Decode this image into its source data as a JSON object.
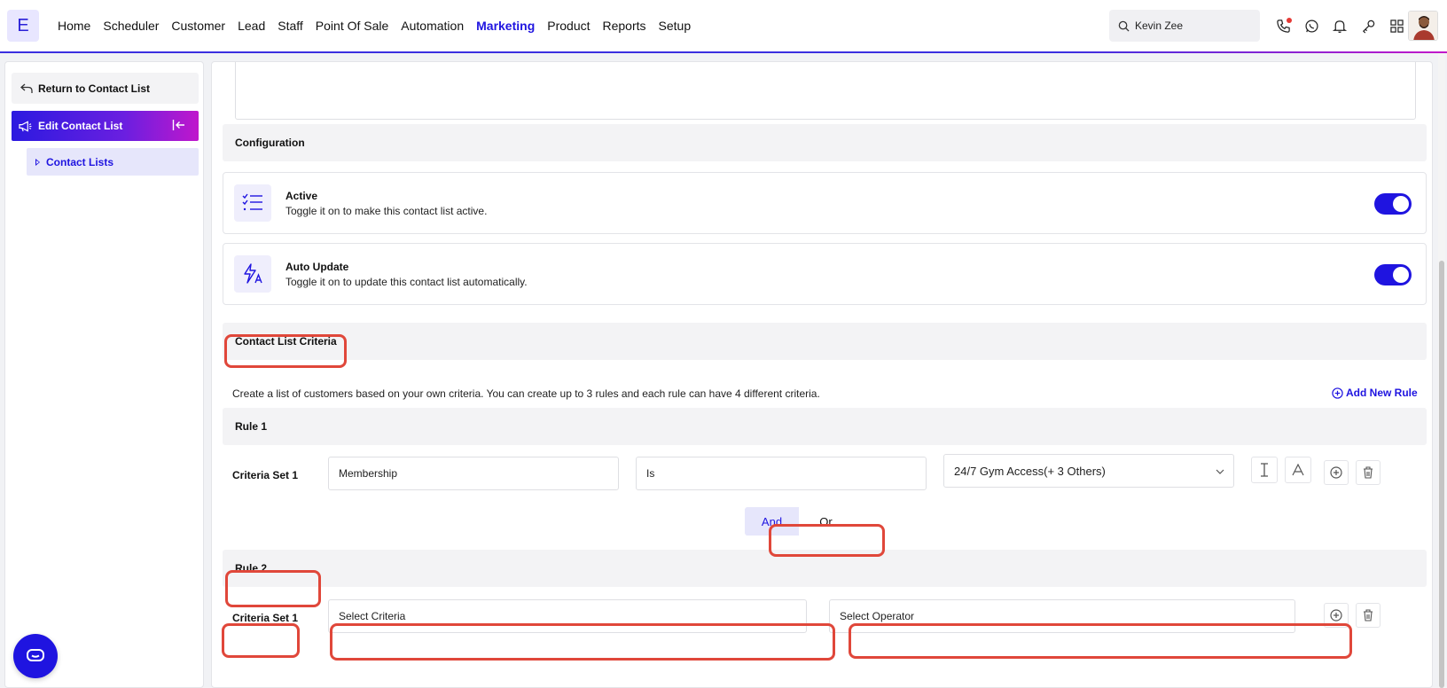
{
  "app": {
    "logo_letter": "E"
  },
  "nav": {
    "items": [
      "Home",
      "Scheduler",
      "Customer",
      "Lead",
      "Staff",
      "Point Of Sale",
      "Automation",
      "Marketing",
      "Product",
      "Reports",
      "Setup"
    ],
    "active": "Marketing"
  },
  "search": {
    "value": "Kevin Zee"
  },
  "top_icons": [
    "phone-icon",
    "whatsapp-icon",
    "bell-icon",
    "key-icon",
    "apps-grid-icon"
  ],
  "sidebar": {
    "back_label": "Return to Contact List",
    "edit_label": "Edit Contact List",
    "sub_label": "Contact Lists"
  },
  "config": {
    "header": "Configuration",
    "active": {
      "title": "Active",
      "desc": "Toggle it on to make this contact list active.",
      "on": true
    },
    "auto_update": {
      "title": "Auto Update",
      "desc": "Toggle it on to update this contact list automatically.",
      "on": true
    }
  },
  "criteria": {
    "header": "Contact List Criteria",
    "desc": "Create a list of customers based on your own criteria. You can create up to 3 rules and each rule can have 4 different criteria.",
    "add_rule": "Add New Rule",
    "rule1": {
      "header": "Rule 1",
      "set_label": "Criteria Set 1",
      "criteria": "Membership",
      "operator": "Is",
      "value": "24/7 Gym Access(+ 3 Others)"
    },
    "logic": {
      "and": "And",
      "or": "Or",
      "selected": "And"
    },
    "rule2": {
      "header": "Rule 2",
      "set_label": "Criteria Set 1",
      "criteria_placeholder": "Select Criteria",
      "operator_placeholder": "Select Operator"
    }
  },
  "colors": {
    "accent": "#1f14e0",
    "highlight": "#e0473a"
  }
}
